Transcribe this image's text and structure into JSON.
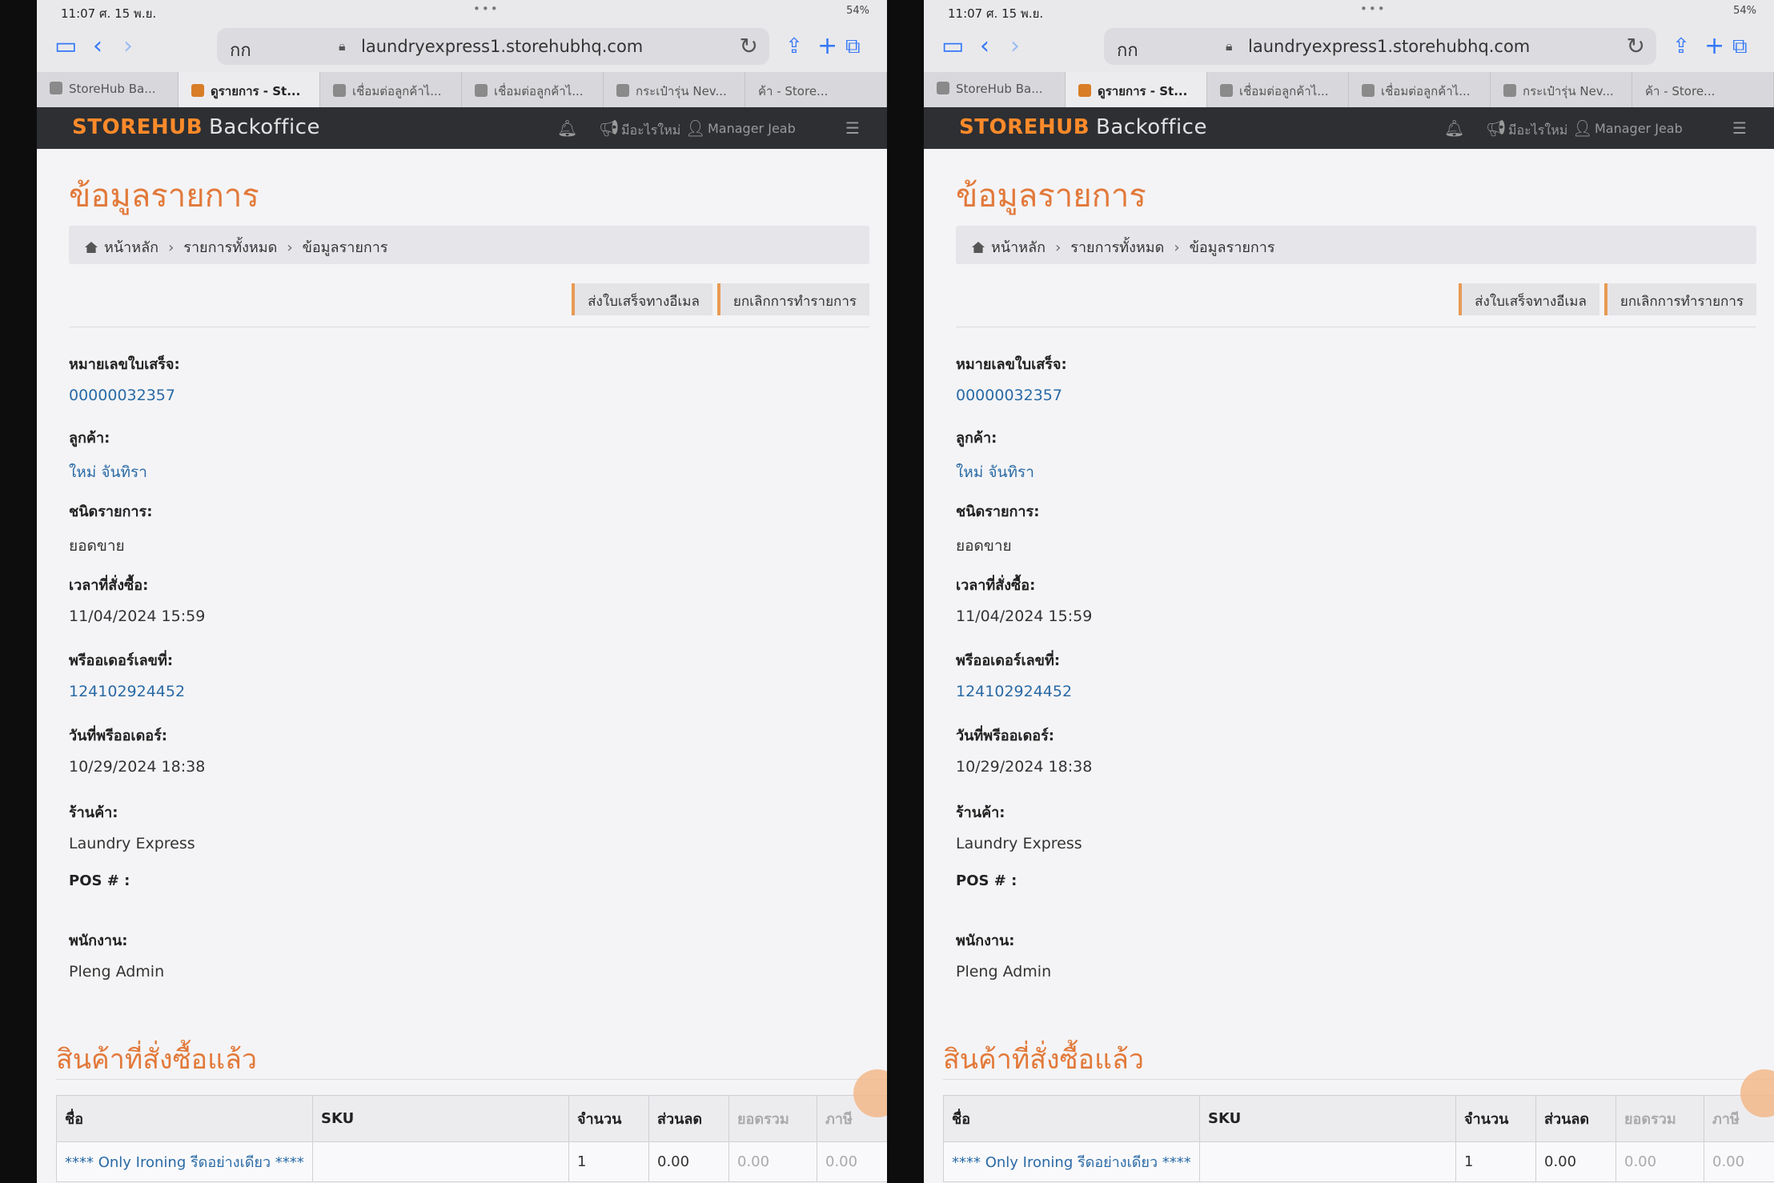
{
  "status": {
    "time": "11:07",
    "date": "ศ. 15 พ.ย.",
    "dots": "•••",
    "battery": "54%"
  },
  "browser": {
    "aa": "กก",
    "url": "laundryexpress1.storehubhq.com",
    "tabs": [
      {
        "label": "StoreHub Ba...",
        "active": false
      },
      {
        "label": "ดูรายการ - St...",
        "active": true
      },
      {
        "label": "เชื่อมต่อลูกค้าไ...",
        "active": false
      },
      {
        "label": "เชื่อมต่อลูกค้าไ...",
        "active": false
      },
      {
        "label": "กระเป๋ารุ่น Nev...",
        "active": false
      },
      {
        "label": "ค้า - Store...",
        "active": false
      }
    ]
  },
  "app": {
    "brand": "STOREHUB",
    "brand_sub": "Backoffice",
    "help": "มีอะไรใหม่",
    "user": "Manager Jeab"
  },
  "page": {
    "title": "ข้อมูลรายการ",
    "breadcrumb": [
      "หน้าหลัก",
      "รายการทั้งหมด",
      "ข้อมูลรายการ"
    ],
    "buttons": {
      "send_email": "ส่งใบเสร็จทางอีเมล",
      "cancel": "ยกเลิกการทำรายการ"
    },
    "fields": [
      {
        "label": "หมายเลขใบเสร็จ:",
        "value": "00000032357",
        "link": true
      },
      {
        "label": "ลูกค้า:",
        "value": "ใหม่ จันทิรา",
        "link": true
      },
      {
        "label": "ชนิดรายการ:",
        "value": "ยอดขาย",
        "link": false
      },
      {
        "label": "เวลาที่สั่งซื้อ:",
        "value": "11/04/2024 15:59",
        "link": false
      },
      {
        "label": "พรีออเดอร์เลขที่:",
        "value": "124102924452",
        "link": true
      },
      {
        "label": "วันที่พรีออเดอร์:",
        "value": "10/29/2024 18:38",
        "link": false
      },
      {
        "label": "ร้านค้า:",
        "value": "Laundry Express",
        "link": false
      },
      {
        "label": "POS # :",
        "value": "",
        "link": false
      },
      {
        "label": "พนักงาน:",
        "value": "Pleng Admin",
        "link": false
      }
    ],
    "section_title": "สินค้าที่สั่งซื้อแล้ว",
    "table": {
      "headers": [
        "ชื่อ",
        "SKU",
        "จำนวน",
        "ส่วนลด",
        "ยอดรวม",
        "ภาษี"
      ],
      "rows": [
        [
          "**** Only Ironing รีดอย่างเดียว ****",
          "",
          "1",
          "0.00",
          "0.00",
          "0.00"
        ]
      ]
    }
  }
}
